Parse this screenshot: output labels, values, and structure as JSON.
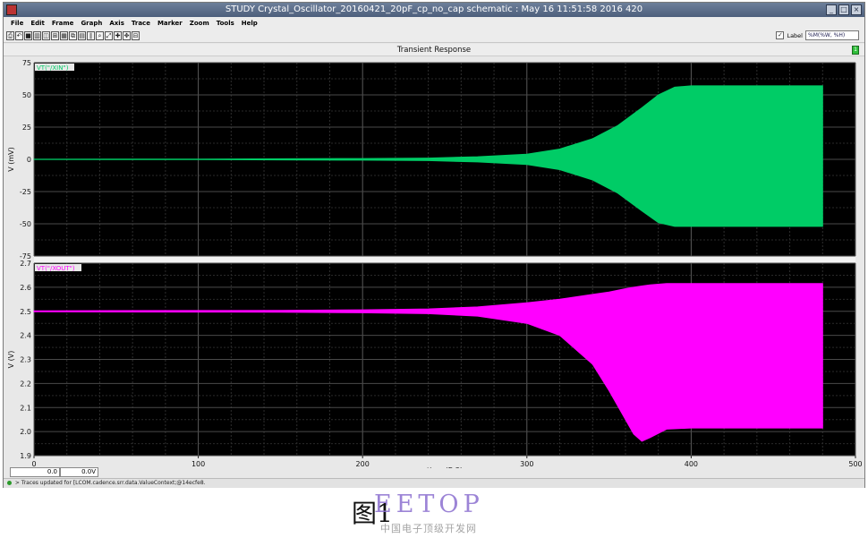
{
  "window": {
    "title": "STUDY Crystal_Oscillator_20160421_20pF_cp_no_cap schematic : May 16 11:51:58 2016 420",
    "buttons": [
      "_",
      "□",
      "×"
    ]
  },
  "menubar": [
    "File",
    "Edit",
    "Frame",
    "Graph",
    "Axis",
    "Trace",
    "Marker",
    "Zoom",
    "Tools",
    "Help"
  ],
  "toolbar": {
    "icons": [
      "print-icon",
      "undo-icon",
      "stop-icon",
      "layout-icon",
      "split-icon",
      "grid-icon",
      "table-icon",
      "new-window-icon",
      "strip-icon",
      "bars-icon",
      "zoom-icon",
      "fit-icon",
      "cross-icon",
      "pan-icon",
      "unzoom-icon"
    ],
    "label_checkbox": "✓",
    "label_text": "Label",
    "label_value": "%M(%W, %H)"
  },
  "chart_title": "Transient Response",
  "title_box": "1",
  "statusbar": {
    "text": "> Traces updated for [LCOM.cadence.srr.data.ValueContext;@14ecfe8."
  },
  "coordinates": {
    "x": "0.0",
    "y": "0.0V"
  },
  "caption": "图1",
  "watermark": {
    "main": "EETOP",
    "sub": "中国电子顶级开发网"
  },
  "chart_data": [
    {
      "type": "line",
      "series": [
        {
          "name": "VT(\"/XIN\")",
          "color": "#00cc66"
        }
      ],
      "ylabel": "V (mV)",
      "ylim": [
        -75,
        75
      ],
      "yticks": [
        "75",
        "50",
        "25",
        "0",
        "-25",
        "-50",
        "-75"
      ],
      "xlim": [
        0,
        500
      ],
      "envelope": {
        "x": [
          0,
          100,
          150,
          200,
          240,
          270,
          300,
          320,
          340,
          355,
          370,
          380,
          390,
          400,
          480
        ],
        "y_top": [
          0.1,
          0.2,
          0.4,
          0.6,
          1,
          2,
          4,
          8,
          16,
          26,
          40,
          50,
          56,
          57,
          57
        ],
        "y_bottom": [
          -0.1,
          -0.2,
          -0.4,
          -0.6,
          -1,
          -2,
          -4,
          -8,
          -16,
          -26,
          -40,
          -49,
          -52,
          -52,
          -52
        ]
      }
    },
    {
      "type": "line",
      "series": [
        {
          "name": "VT(\"/XOUT\")",
          "color": "#ff00ff"
        }
      ],
      "ylabel": "V (V)",
      "ylim": [
        1.9,
        2.7
      ],
      "yticks": [
        "2.7",
        "2.6",
        "2.5",
        "2.4",
        "2.3",
        "2.2",
        "2.1",
        "2.0",
        "1.9"
      ],
      "xlim": [
        0,
        500
      ],
      "xticks": [
        "0",
        "100",
        "200",
        "300",
        "400",
        "500"
      ],
      "xlabel": "time (E-3)",
      "envelope": {
        "x": [
          0,
          100,
          150,
          200,
          240,
          270,
          300,
          320,
          340,
          350,
          360,
          365,
          370,
          375,
          385,
          400,
          480
        ],
        "y_top": [
          2.502,
          2.503,
          2.504,
          2.506,
          2.51,
          2.518,
          2.535,
          2.55,
          2.57,
          2.58,
          2.594,
          2.6,
          2.605,
          2.61,
          2.615,
          2.615,
          2.615
        ],
        "y_bottom": [
          2.498,
          2.497,
          2.496,
          2.494,
          2.49,
          2.48,
          2.45,
          2.4,
          2.28,
          2.17,
          2.05,
          1.99,
          1.96,
          1.975,
          2.01,
          2.015,
          2.015
        ]
      }
    }
  ]
}
